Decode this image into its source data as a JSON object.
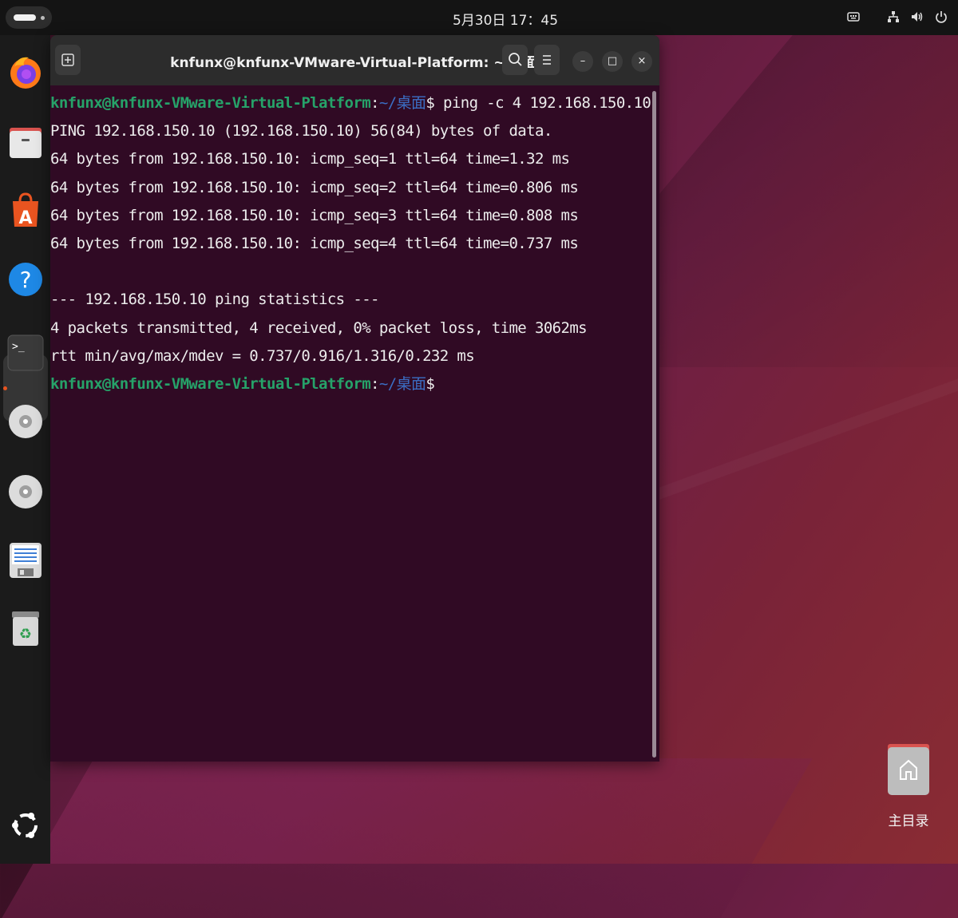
{
  "topbar": {
    "clock": "5月30日 17：45",
    "tray_icons": [
      "keyboard-icon",
      "network-icon",
      "volume-icon",
      "power-icon"
    ]
  },
  "dock": {
    "items": [
      "firefox-icon",
      "files-icon",
      "app-center-icon",
      "help-icon",
      "terminal-icon",
      "disc-icon",
      "disc-icon",
      "text-editor-icon",
      "trash-icon"
    ],
    "show_apps_icon": "ubuntu-logo-icon",
    "accent": "#e95420"
  },
  "terminal": {
    "title": "knfunx@knfunx-VMware-Virtual-Platform: ~/桌面",
    "prompt_user": "knfunx@knfunx-VMware-Virtual-Platform",
    "prompt_sep": ":",
    "prompt_path": "~/桌面",
    "prompt_symbol": "$",
    "command": " ping -c 4 192.168.150.10",
    "output": [
      "PING 192.168.150.10 (192.168.150.10) 56(84) bytes of data.",
      "64 bytes from 192.168.150.10: icmp_seq=1 ttl=64 time=1.32 ms",
      "64 bytes from 192.168.150.10: icmp_seq=2 ttl=64 time=0.806 ms",
      "64 bytes from 192.168.150.10: icmp_seq=3 ttl=64 time=0.808 ms",
      "64 bytes from 192.168.150.10: icmp_seq=4 ttl=64 time=0.737 ms",
      "",
      "--- 192.168.150.10 ping statistics ---",
      "4 packets transmitted, 4 received, 0% packet loss, time 3062ms",
      "rtt min/avg/max/mdev = 0.737/0.916/1.316/0.232 ms"
    ],
    "minimize": "–",
    "maximize": "□",
    "close": "×",
    "colors": {
      "background": "#300a24",
      "user": "#26a269",
      "path": "#3b6ec4"
    }
  },
  "desktop": {
    "home_label": "主目录"
  }
}
